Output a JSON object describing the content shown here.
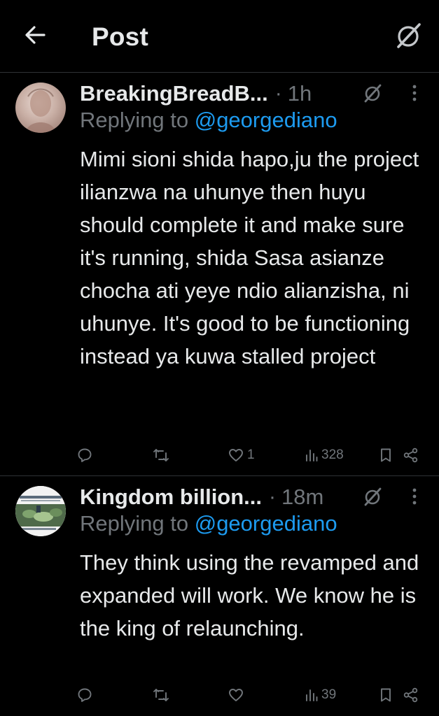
{
  "header": {
    "title": "Post"
  },
  "colors": {
    "background": "#000000",
    "text_primary": "#e7e9ea",
    "text_secondary": "#71767b",
    "link": "#1d9bf0",
    "divider": "#2f3336"
  },
  "posts": [
    {
      "author": "BreakingBreadB...",
      "separator": "·",
      "time": "1h",
      "replying_label": "Replying to",
      "replying_handle": "@georgediano",
      "text": "Mimi sioni shida hapo,ju the project ilianzwa na uhunye then huyu should complete it and make sure it's running, shida Sasa asianze chocha ati yeye ndio alianzisha, ni uhunye. It's good to be functioning instead ya kuwa stalled project",
      "reply_count": "",
      "repost_count": "",
      "like_count": "1",
      "view_count": "328"
    },
    {
      "author": "Kingdom billion...",
      "separator": "·",
      "time": "18m",
      "replying_label": "Replying to",
      "replying_handle": "@georgediano",
      "text": "They think using the revamped and expanded will work. We know he is the king of relaunching.",
      "reply_count": "",
      "repost_count": "",
      "like_count": "",
      "view_count": "39"
    }
  ],
  "icons": {
    "back": "arrow-left-icon",
    "grok": "grok-icon",
    "more": "more-vertical-icon",
    "reply": "reply-bubble-icon",
    "repost": "repost-icon",
    "like": "heart-icon",
    "views": "views-chart-icon",
    "bookmark": "bookmark-icon",
    "share": "share-icon"
  }
}
